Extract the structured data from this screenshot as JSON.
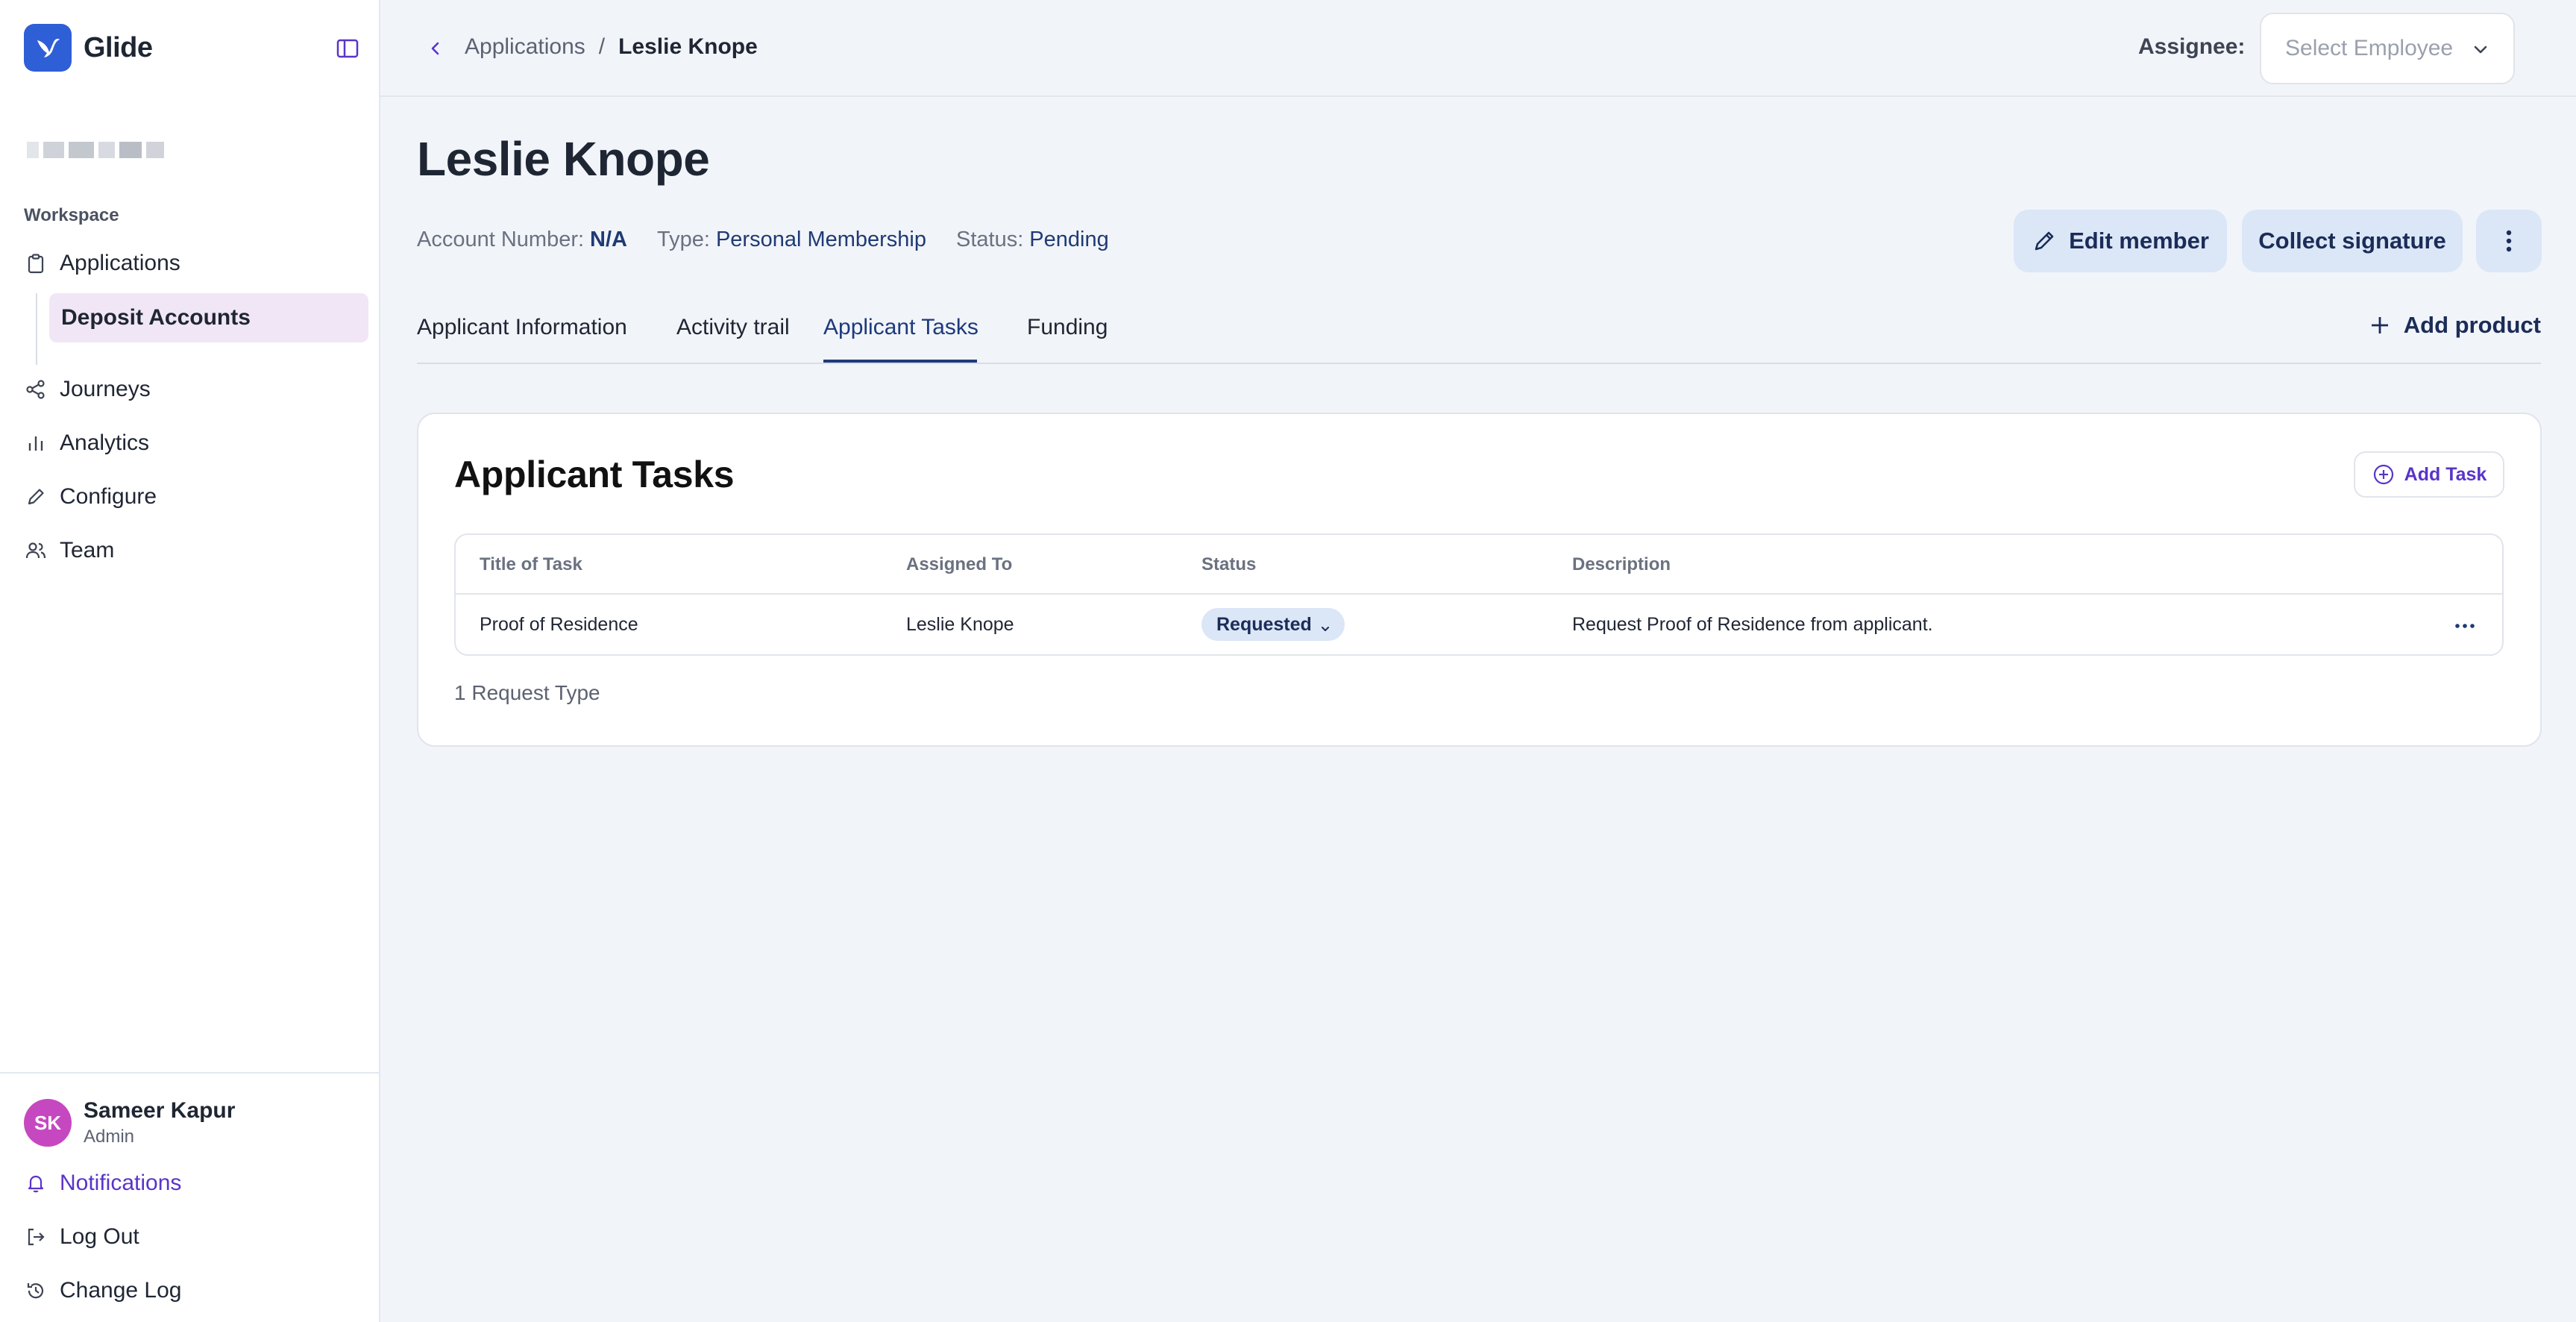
{
  "brand": {
    "name": "Glide"
  },
  "sidebar": {
    "section_label": "Workspace",
    "items": [
      {
        "label": "Applications",
        "icon": "clipboard-icon"
      },
      {
        "label": "Deposit Accounts"
      },
      {
        "label": "Journeys",
        "icon": "share-nodes-icon"
      },
      {
        "label": "Analytics",
        "icon": "bar-chart-icon"
      },
      {
        "label": "Configure",
        "icon": "pencil-icon"
      },
      {
        "label": "Team",
        "icon": "users-icon"
      }
    ]
  },
  "user": {
    "initials": "SK",
    "name": "Sameer Kapur",
    "role": "Admin"
  },
  "footer_links": {
    "notifications": "Notifications",
    "logout": "Log Out",
    "changelog": "Change Log"
  },
  "breadcrumb": {
    "parent": "Applications",
    "separator": "/",
    "current": "Leslie Knope"
  },
  "assignee": {
    "label": "Assignee:",
    "placeholder": "Select Employee"
  },
  "page": {
    "title": "Leslie Knope",
    "meta": {
      "account_label": "Account Number:",
      "account_value": "N/A",
      "type_label": "Type:",
      "type_value": "Personal Membership",
      "status_label": "Status:",
      "status_value": "Pending"
    },
    "actions": {
      "edit": "Edit member",
      "collect": "Collect signature"
    }
  },
  "tabs": [
    "Applicant Information",
    "Activity trail",
    "Applicant Tasks",
    "Funding"
  ],
  "active_tab": "Applicant Tasks",
  "add_product": "Add product",
  "card": {
    "title": "Applicant Tasks",
    "add_task": "Add Task",
    "columns": [
      "Title of Task",
      "Assigned To",
      "Status",
      "Description"
    ],
    "rows": [
      {
        "title": "Proof of Residence",
        "assigned_to": "Leslie Knope",
        "status": "Requested",
        "description": "Request Proof of Residence from applicant."
      }
    ],
    "footer": "1 Request Type"
  },
  "colors": {
    "brand": "#2f5fd6",
    "accent": "#5a34c8",
    "navy": "#1e3a7b",
    "soft_blue": "#dbe6f7",
    "active_nav_bg": "#f1e6f6"
  }
}
